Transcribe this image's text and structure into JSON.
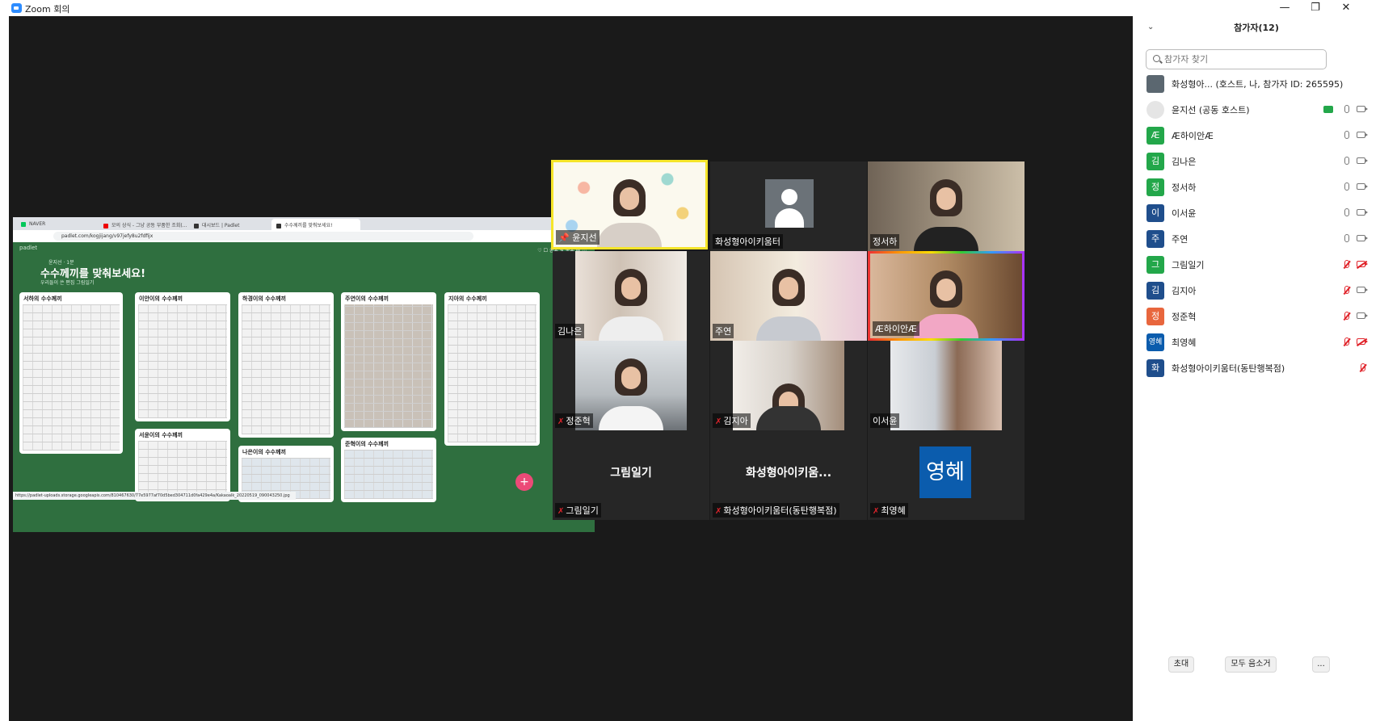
{
  "window": {
    "title": "Zoom 회의",
    "minimize": "—",
    "restore": "❐",
    "close": "✕"
  },
  "share": {
    "browser_tabs": [
      "NAVER",
      "모의 상식 - 그냥 공동 부품한 조회(...",
      "대시보드 | Padlet",
      "수수께끼를 맞춰보세요!"
    ],
    "address": "padlet.com/kogjijang/v97jefy8u2fdfijx",
    "logo": "padlet",
    "author": "윤지선 · 1분",
    "title": "수수께끼를 맞춰보세요!",
    "subtitle": "우리들이 쓴 편집 그림일기",
    "toolbar": "♡  ☐ 공유  ✎ 공유  ⚙  ⋯",
    "status_url": "https://padlet-uploads.storage.googleapis.com/810467630/77e5977af70d5bed304711d0fa429e4a/Kakaoalk_20220519_090043250.jpg",
    "cards": [
      {
        "title": "서하의 수수께끼"
      },
      {
        "title": "이안이의 수수께끼"
      },
      {
        "title": "서윤이의 수수께끼"
      },
      {
        "title": "하경이의 수수께끼"
      },
      {
        "title": "나은이의 수수께끼"
      },
      {
        "title": "주연이의 수수께끼"
      },
      {
        "title": "준혁이의 수수께끼"
      },
      {
        "title": "지아의 수수께끼"
      }
    ],
    "fab": "+"
  },
  "gallery": [
    {
      "name": "윤지선",
      "muted": false,
      "pinned": true
    },
    {
      "name": "화성형아이키움터",
      "muted": false
    },
    {
      "name": "정서하",
      "muted": false
    },
    {
      "name": "김나은",
      "muted": false
    },
    {
      "name": "주연",
      "muted": false
    },
    {
      "name": "Æ하이안Æ",
      "muted": false
    },
    {
      "name": "정준혁",
      "muted": true
    },
    {
      "name": "김지아",
      "muted": true
    },
    {
      "name": "이서윤",
      "muted": false
    },
    {
      "name": "그림일기",
      "muted": true,
      "big": "그림일기"
    },
    {
      "name": "화성형아이키움터(동탄행복점)",
      "muted": true,
      "big": "화성형아이키움..."
    },
    {
      "name": "최영혜",
      "muted": true,
      "avatar": "영혜"
    }
  ],
  "panel": {
    "header": "참가자(12)",
    "search_placeholder": "참가자 찾기",
    "participants": [
      {
        "name": "화성형아... (호스트, 나, 참가자 ID: 265595)",
        "initial": "",
        "color": "#5b6770",
        "mic": "none",
        "cam": "none"
      },
      {
        "name": "윤지선 (공동 호스트)",
        "initial": "",
        "color": "#cccccc",
        "mic": "on",
        "cam": "on",
        "sharing": true
      },
      {
        "name": "Æ하이안Æ",
        "initial": "Æ",
        "color": "#23a74a",
        "mic": "on",
        "cam": "on"
      },
      {
        "name": "김나은",
        "initial": "김",
        "color": "#23a74a",
        "mic": "on",
        "cam": "on"
      },
      {
        "name": "정서하",
        "initial": "정",
        "color": "#23a74a",
        "mic": "on",
        "cam": "on"
      },
      {
        "name": "이서윤",
        "initial": "이",
        "color": "#1f4e8c",
        "mic": "on",
        "cam": "on"
      },
      {
        "name": "주연",
        "initial": "주",
        "color": "#1f4e8c",
        "mic": "on",
        "cam": "on"
      },
      {
        "name": "그림일기",
        "initial": "그",
        "color": "#23a74a",
        "mic": "muted",
        "cam": "muted"
      },
      {
        "name": "김지아",
        "initial": "김",
        "color": "#1f4e8c",
        "mic": "muted",
        "cam": "on"
      },
      {
        "name": "정준혁",
        "initial": "정",
        "color": "#e8663d",
        "mic": "muted",
        "cam": "on"
      },
      {
        "name": "최영혜",
        "initial": "영혜",
        "color": "#0b5cad",
        "mic": "muted",
        "cam": "muted"
      },
      {
        "name": "화성형아이키움터(동탄행복점)",
        "initial": "화",
        "color": "#1f4e8c",
        "mic": "muted",
        "cam": "none"
      }
    ],
    "buttons": {
      "invite": "초대",
      "mute_all": "모두 음소거",
      "more": "..."
    }
  }
}
